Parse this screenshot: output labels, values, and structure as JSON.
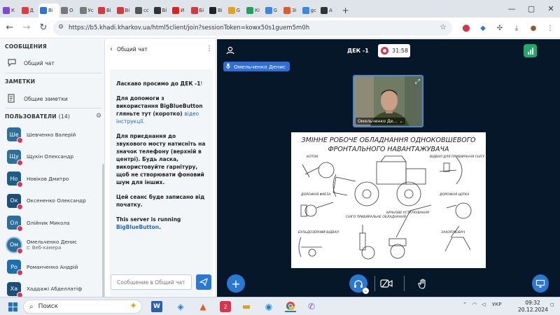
{
  "browser": {
    "tabs": [
      {
        "label": "К",
        "color": "#7b4bd6"
      },
      {
        "label": "Д",
        "color": "#e23a3a"
      },
      {
        "label": "Ві",
        "color": "#2b78d4",
        "active": true
      },
      {
        "label": "О",
        "color": "#777777"
      },
      {
        "label": "Ус",
        "color": "#7a7a7a"
      },
      {
        "label": "Ві",
        "color": "#d53a3a"
      },
      {
        "label": "Ві",
        "color": "#d53a3a"
      },
      {
        "label": "сс",
        "color": "#555555"
      },
      {
        "label": "Ві",
        "color": "#333333"
      },
      {
        "label": "И",
        "color": "#e02020"
      },
      {
        "label": "Бі",
        "color": "#d53a3a"
      },
      {
        "label": "Ві",
        "color": "#222222"
      },
      {
        "label": "G",
        "color": "#e0a41a"
      },
      {
        "label": "Кі",
        "color": "#1ea35e"
      },
      {
        "label": "G",
        "color": "#3a88e0"
      },
      {
        "label": "Зі",
        "color": "#e05a2a"
      },
      {
        "label": "gc",
        "color": "#3a88e0"
      },
      {
        "label": "А",
        "color": "#333333"
      }
    ],
    "url": "https://b5.khadi.kharkov.ua/html5client/join?sessionToken=kowx50s1guem5m0h"
  },
  "sidebar": {
    "messages_title": "СООБЩЕНИЯ",
    "public_chat": "Общий чат",
    "notes_title": "ЗАМЕТКИ",
    "shared_notes": "Общие заметки",
    "users_title": "ПОЛЬЗОВАТЕЛИ",
    "users_count": "(14)",
    "users": [
      {
        "initials": "Ше",
        "name": "Шевченко Валерій",
        "sub": "",
        "color": "#2b6f9c"
      },
      {
        "initials": "Щу",
        "name": "Щукін Олександр",
        "sub": "",
        "color": "#2b6f9c"
      },
      {
        "initials": "Но",
        "name": "Новіков Дмитро",
        "sub": "",
        "color": "#1b5e8a"
      },
      {
        "initials": "Ок",
        "name": "Оксененко Олександр",
        "sub": "",
        "color": "#1b4f7a"
      },
      {
        "initials": "Ол",
        "name": "Олійник Микола",
        "sub": "",
        "color": "#2b6f9c"
      },
      {
        "initials": "Ом",
        "name": "Омельченко Денис",
        "sub": "⊏ Веб-камера",
        "color": "#2b6f9c",
        "me": true
      },
      {
        "initials": "Ро",
        "name": "Романченко Андрій",
        "sub": "",
        "color": "#1b6fb0"
      },
      {
        "initials": "Ха",
        "name": "Хаддажі Абделлатіф",
        "sub": "",
        "color": "#1b4f7a"
      }
    ]
  },
  "chat": {
    "title": "Общий чат",
    "welcome_prefix": "Ласкаво просимо до ",
    "welcome_room": "ДЕК -1",
    "welcome_suffix": "!",
    "help_text": "Для допомоги з використання BigBlueButton гляньте тут (коротко) ",
    "help_link": "відео інструкції.",
    "audio_text": "Для приєднання до звукового мосту натисніть на значок телефону (верхній в центрі). Будь ласка, використовуйте гарнітуру, щоб не створювати фоновий шум для інших.",
    "record_text": "Цей сеанс буде записано від початку.",
    "running_text": "This server is running ",
    "running_link": "BigBlueButton",
    "running_suffix": ".",
    "input_placeholder": "Сообщение в Общий чат"
  },
  "main": {
    "room_name": "ДЕК -1",
    "timer": "31:58",
    "speaker_name": "Омельченко Денис",
    "camera_label": "Омельченко Де...",
    "slide": {
      "title_line1": "ЗМІННЕ РОБОЧЕ ОБЛАДНАННЯ ОДНОКОВШЕВОГО",
      "title_line2": "ФРОНТАЛЬНОГО НАВАНТАЖУВАЧА",
      "labels": [
        "КОТОК",
        "ВІДВАЛ ДЛЯ ПРИБИРАННЯ СНІГУ",
        "ДОРОЖНЯ ФРЕЗА",
        "ДОРОЖНЯ ЩІТКА",
        "КРАНОВЕ УСТАТКУВАННЯ",
        "СНІГО ПРИБИРАЛЬНЕ ОБЛАДНАННЯ",
        "БУЛЬДОЗЕРНИЙ ВІДВАЛ",
        "ЗАХОПЛЮВАЧ"
      ]
    }
  },
  "taskbar": {
    "search": "Поиск",
    "lang": "УКР",
    "time": "09:32",
    "date": "20.12.2024",
    "notif_count": "2"
  }
}
